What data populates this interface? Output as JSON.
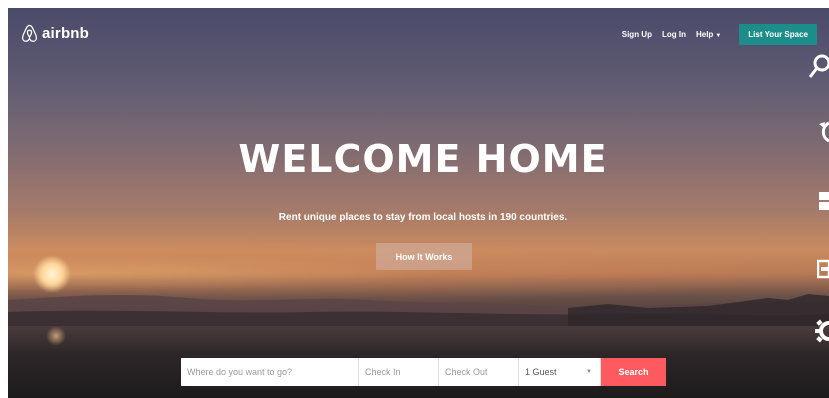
{
  "header": {
    "logo_text": "airbnb",
    "nav": {
      "sign_up": "Sign Up",
      "log_in": "Log In",
      "help": "Help",
      "list_space": "List Your Space"
    }
  },
  "hero": {
    "title": "WELCOME HOME",
    "subtitle": "Rent unique places to stay from local hosts in 190 countries.",
    "how_it_works": "How It Works"
  },
  "search": {
    "where_placeholder": "Where do you want to go?",
    "check_in": "Check In",
    "check_out": "Check Out",
    "guests": "1 Guest",
    "button": "Search"
  },
  "colors": {
    "brand_teal": "#1c8d8a",
    "search_red": "#ff5a5f"
  },
  "icons": [
    "airbnb-logo-icon",
    "search-icon",
    "refresh-icon",
    "windows-icon",
    "battery-icon",
    "gear-icon",
    "chevron-down-icon"
  ]
}
